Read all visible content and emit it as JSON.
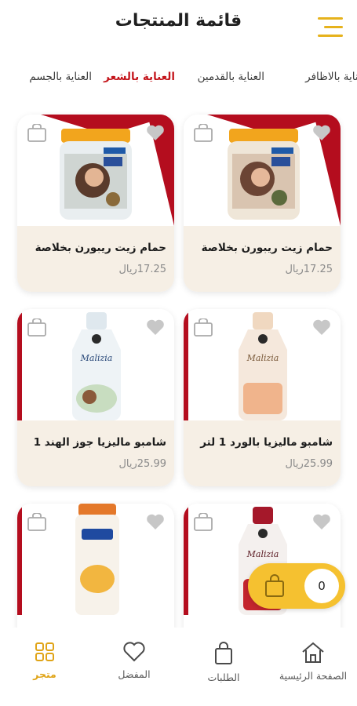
{
  "header": {
    "title": "قائمة المنتجات",
    "menu_icon": "hamburger-menu-icon"
  },
  "categories": [
    {
      "label": "عناية بالاظافر",
      "active": false
    },
    {
      "label": "العناية بالقدمين",
      "active": false
    },
    {
      "label": "العناية بالشعر",
      "active": true
    },
    {
      "label": "العناية بالجسم",
      "active": false
    }
  ],
  "products": [
    {
      "name": "حمام زيت ريبورن بخلاصة",
      "price": "17.25ريال"
    },
    {
      "name": "حمام زيت ريبورن  بخلاصة",
      "price": "17.25ريال"
    },
    {
      "name": "شامبو ماليزيا بالورد 1 لتر",
      "price": "25.99ريال",
      "brand": "Malizia"
    },
    {
      "name": "شامبو ماليزيا جوز الهند 1",
      "price": "25.99ريال",
      "brand": "Malizia"
    },
    {
      "name": "",
      "price": "",
      "brand": "Malizia"
    },
    {
      "name": "",
      "price": "",
      "brand": ""
    }
  ],
  "cart": {
    "count": "0"
  },
  "bottom_nav": [
    {
      "label": "الصفحة الرئيسية",
      "icon": "home-icon"
    },
    {
      "label": "الطلبات",
      "icon": "shopping-bag-icon"
    },
    {
      "label": "المفضل",
      "icon": "heart-icon"
    },
    {
      "label": "متجر",
      "icon": "grid-icon",
      "active": true
    }
  ],
  "colors": {
    "accent": "#e6b21c",
    "brand_red": "#b40d1e",
    "card_info_bg": "#f6efe5",
    "active_category": "#c4161c"
  }
}
